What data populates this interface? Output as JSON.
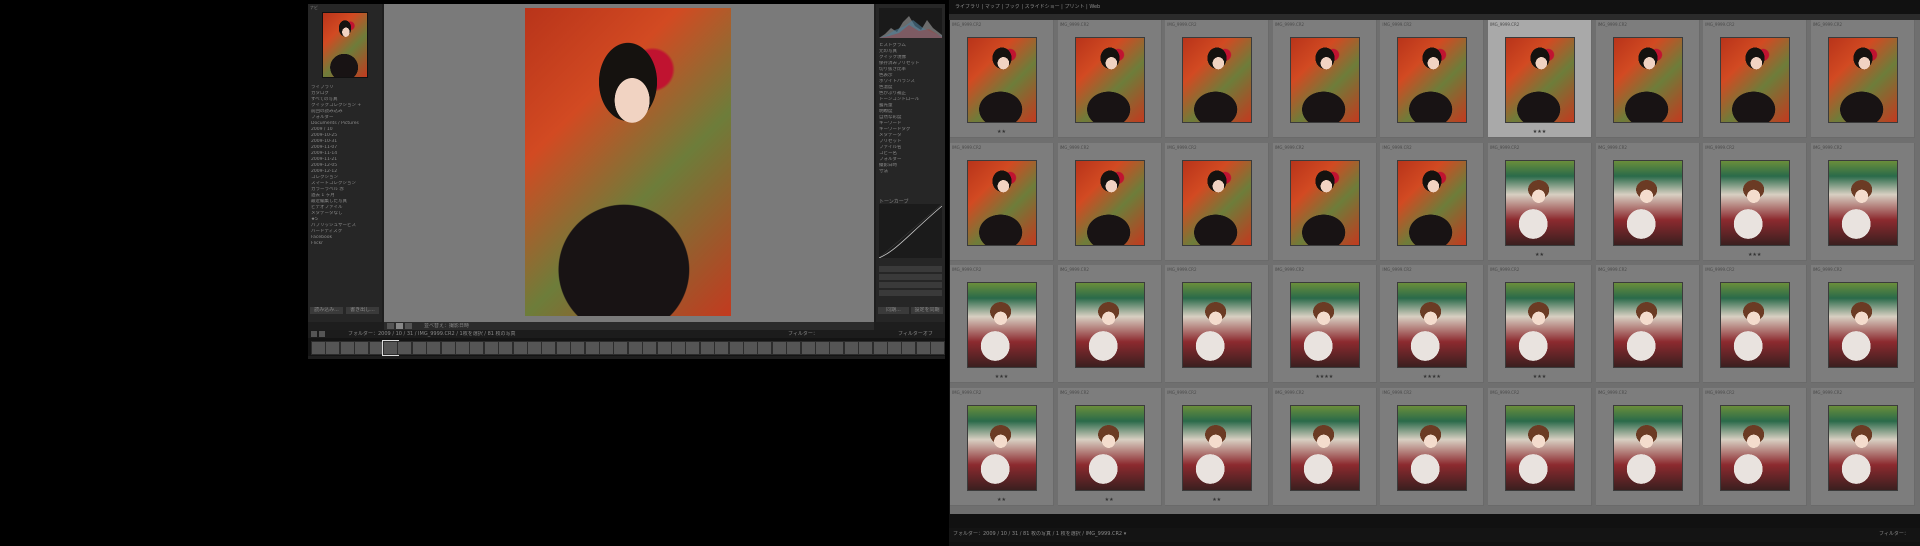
{
  "left_window": {
    "navigator_label": "ナビ",
    "left_panel_rows": [
      "ライブラリ",
      "カタログ",
      "すべての写真",
      "クイックコレクション +",
      "前回の読み込み",
      "フォルダー",
      "Documents / Pictures",
      "2009 / 10",
      "2009-10-25",
      "2009-10-31",
      "2009-11-07",
      "2009-11-14",
      "2009-11-21",
      "2009-12-05",
      "2009-12-12",
      "コレクション",
      "スマートコレクション",
      "カラーラベル 赤",
      "過去 1 ヶ月",
      "最近編集した写真",
      "ビデオファイル",
      "メタデータなし",
      "★5",
      "パブリッシュサービス",
      "ハードディスク",
      "Facebook",
      "Flickr"
    ],
    "left_buttons": {
      "import": "読み込み...",
      "export": "書き出し..."
    },
    "right_panel_rows": [
      "ヒストグラム",
      "元の写真",
      "クイック現像",
      "保存済みプリセット",
      "切り抜き比率",
      "色表示",
      "ホワイトバランス",
      "色温度",
      "色かぶり補正",
      "トーンコントロール",
      "露光量",
      "明瞭度",
      "自然な彩度",
      "キーワード",
      "キーワードタグ",
      "メタデータ",
      "プリセット",
      "ファイル名",
      "コピー名",
      "フォルダー",
      "撮影日時",
      "寸法"
    ],
    "right_buttons": {
      "sync": "同期...",
      "sync_settings": "設定を同期"
    },
    "tone_curve_label": "トーンカーブ",
    "toolbar_label": "並べ替え：撮影日時",
    "filmstrip_path": "フォルダー：2009 / 10 / 31 / IMG_9999.CR2 / 1枚を選択 / 81 枚の写真",
    "filter_label": "フィルター：",
    "filter_value": "フィルターオフ"
  },
  "right_window": {
    "tabs_path": "ライブラリ  |  マップ  |  ブック  |  スライドショー  |  プリント  |  Web",
    "grid_rows": [
      [
        "kimono",
        "kimono",
        "kimono",
        "kimono",
        "kimono",
        "kimono",
        "kimono",
        "kimono",
        "kimono"
      ],
      [
        "kimono",
        "kimono",
        "kimono",
        "kimono",
        "kimono",
        "shrine",
        "shrine",
        "shrine",
        "shrine"
      ],
      [
        "shrine",
        "shrine",
        "shrine",
        "shrine",
        "shrine",
        "shrine",
        "shrine",
        "shrine",
        "shrine"
      ],
      [
        "shrine",
        "shrine",
        "shrine",
        "shrine",
        "shrine",
        "shrine",
        "shrine",
        "shrine",
        "shrine"
      ]
    ],
    "cell_caption": "IMG_9999.CR2",
    "selected_cell": [
      0,
      5
    ],
    "ratings": [
      [
        "★★",
        "",
        "",
        "",
        "",
        "★★★",
        "",
        "",
        ""
      ],
      [
        "",
        "",
        "",
        "",
        "",
        "★★",
        "",
        "★★★",
        ""
      ],
      [
        "★★★",
        "",
        "",
        "★★★★",
        "★★★★",
        "★★★",
        "",
        "",
        ""
      ],
      [
        "★★",
        "★★",
        "★★",
        "",
        "",
        "",
        "",
        "",
        ""
      ]
    ],
    "bottom_path": "フォルダー：2009 / 10 / 31 / 81 枚の写真 / 1 枚を選択 / IMG_9999.CR2 ▾",
    "bottom_right": "フィルター："
  },
  "colors": {
    "bg": "#000000",
    "panel": "#262626",
    "grid_bg": "#7d7d7d",
    "selected": "#a9a9a9"
  }
}
